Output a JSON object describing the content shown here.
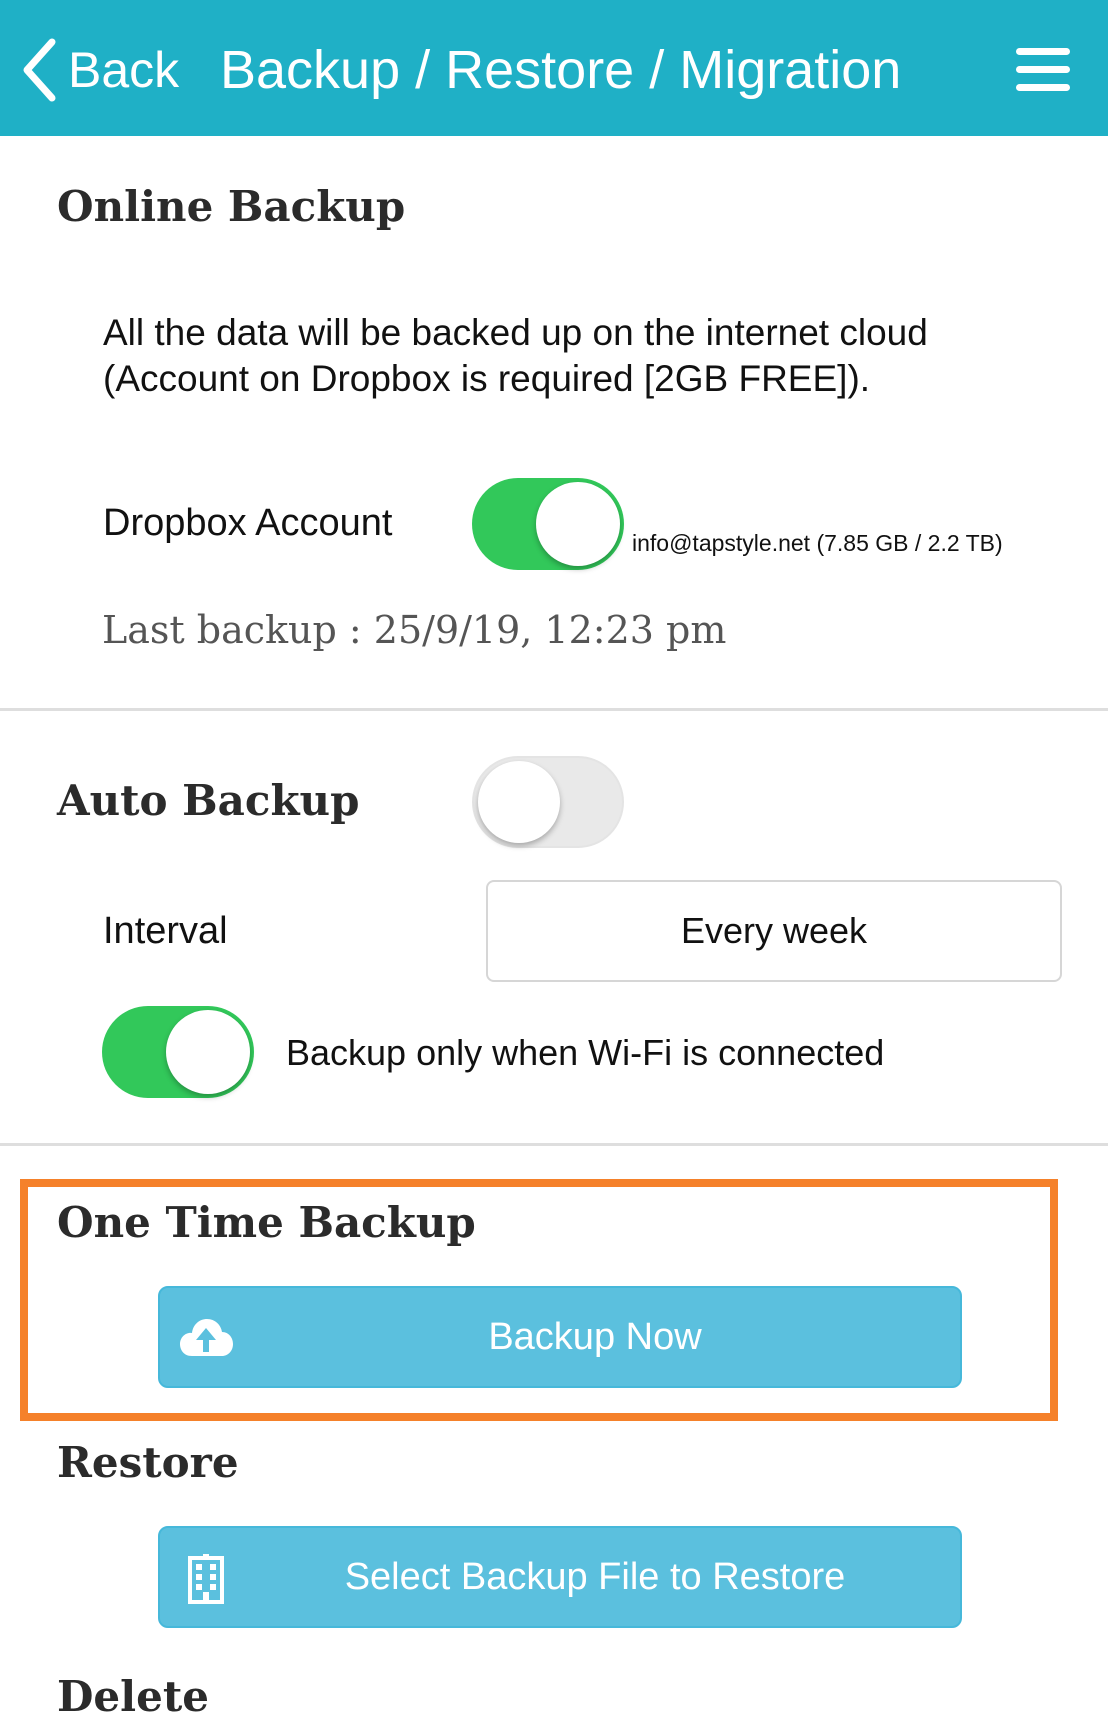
{
  "navbar": {
    "back_label": "Back",
    "title": "Backup / Restore / Migration",
    "back_icon": "chevron-left-icon",
    "menu_icon": "hamburger-menu-icon",
    "background_color": "#1fb0c6"
  },
  "online_backup": {
    "title": "Online Backup",
    "description": "All the data will be backed up on the internet cloud (Account on Dropbox is required [2GB FREE]).",
    "dropbox_label": "Dropbox Account",
    "dropbox_toggle_on": true,
    "account_info": "info@tapstyle.net (7.85 GB / 2.2 TB)",
    "last_backup": "Last backup : 25/9/19, 12:23 pm"
  },
  "auto_backup": {
    "title": "Auto Backup",
    "toggle_on": false,
    "interval_label": "Interval",
    "interval_value": "Every week",
    "wifi_toggle_on": true,
    "wifi_label": "Backup only when Wi-Fi is connected"
  },
  "one_time_backup": {
    "title": "One Time Backup",
    "button_label": "Backup Now",
    "button_icon": "cloud-upload-icon",
    "highlight_color": "#f5812a"
  },
  "restore": {
    "title": "Restore",
    "button_label": "Select Backup File to Restore",
    "button_icon": "building-icon"
  },
  "delete": {
    "title": "Delete"
  },
  "colors": {
    "toggle_on": "#32c85a",
    "button_bg": "#5bc0de"
  }
}
